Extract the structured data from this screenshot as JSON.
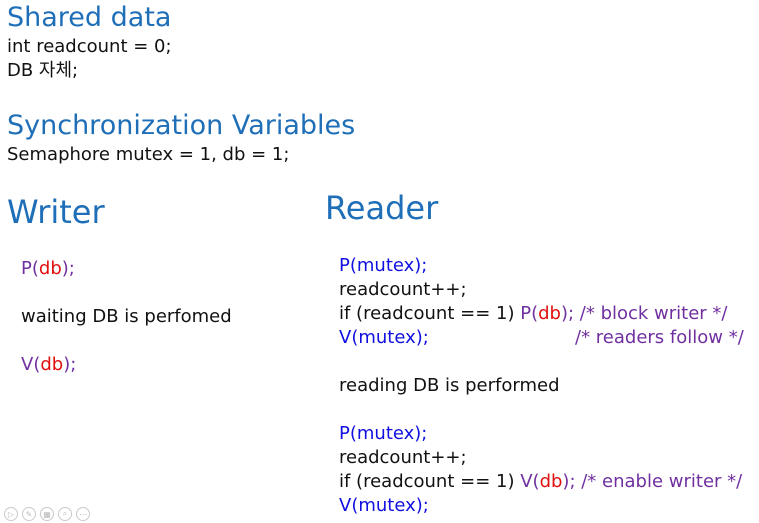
{
  "shared": {
    "title": "Shared data",
    "line1": "int readcount = 0;",
    "line2": "DB 자체;"
  },
  "sync": {
    "title": "Synchronization Variables",
    "line1": "Semaphore mutex = 1, db = 1;"
  },
  "writer": {
    "title": "Writer",
    "p_fn": "P(",
    "p_arg": "db",
    "p_end": ");",
    "waiting": "waiting DB is perfomed",
    "v_fn": "V(",
    "v_arg": "db",
    "v_end": ");"
  },
  "reader": {
    "title": "Reader",
    "l1": "P(mutex);",
    "l2": "readcount++;",
    "l3_pre": "if (readcount == 1) ",
    "l3_fn": "P(",
    "l3_arg": "db",
    "l3_end": ");",
    "l3_comment": " /* block writer */",
    "l4": "V(mutex);",
    "l4_comment": "/* readers follow */",
    "l5": "reading DB is performed",
    "l6": "P(mutex);",
    "l7": "readcount++;",
    "l8_pre": "if (readcount == 1) ",
    "l8_fn": "V(",
    "l8_arg": "db",
    "l8_end": ");",
    "l8_comment": " /* enable writer */",
    "l9": "V(mutex);"
  },
  "toolbar": {
    "icons": [
      "play-icon",
      "pen-icon",
      "slides-icon",
      "zoom-icon",
      "more-icon"
    ]
  }
}
